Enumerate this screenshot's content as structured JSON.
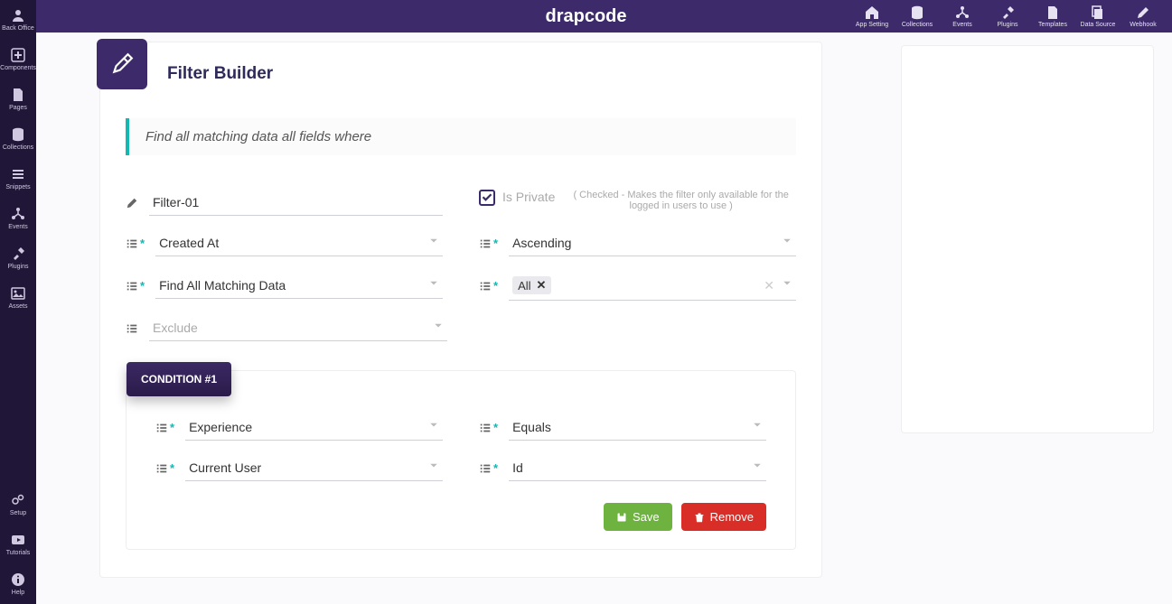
{
  "brand": "drapcode",
  "toolbar": [
    {
      "label": "App Setting",
      "icon": "home"
    },
    {
      "label": "Collections",
      "icon": "db"
    },
    {
      "label": "Events",
      "icon": "tree"
    },
    {
      "label": "Plugins",
      "icon": "tools"
    },
    {
      "label": "Templates",
      "icon": "doc"
    },
    {
      "label": "Data Source",
      "icon": "copy"
    },
    {
      "label": "Webhook",
      "icon": "pencil"
    }
  ],
  "leftRailTop": [
    {
      "label": "Back Office",
      "icon": "user"
    },
    {
      "label": "Components",
      "icon": "plus"
    },
    {
      "label": "Pages",
      "icon": "doc"
    },
    {
      "label": "Collections",
      "icon": "db"
    },
    {
      "label": "Snippets",
      "icon": "bars"
    },
    {
      "label": "Events",
      "icon": "tree"
    },
    {
      "label": "Plugins",
      "icon": "tools"
    },
    {
      "label": "Assets",
      "icon": "image"
    }
  ],
  "leftRailBottom": [
    {
      "label": "Setup",
      "icon": "gears"
    },
    {
      "label": "Tutorials",
      "icon": "play"
    },
    {
      "label": "Help",
      "icon": "info"
    }
  ],
  "page": {
    "title": "Filter Builder",
    "quote": "Find all matching data all fields where",
    "filterName": "Filter-01",
    "isPrivateLabel": "Is Private",
    "isPrivateHint": "( Checked - Makes the filter only available for the logged in users to use )",
    "sortField": "Created At",
    "sortOrder": "Ascending",
    "matchType": "Find All Matching Data",
    "tag": "All",
    "excludePh": "Exclude",
    "condition": {
      "badge": "CONDITION #1",
      "field": "Experience",
      "op": "Equals",
      "source": "Current User",
      "key": "Id"
    },
    "saveLabel": "Save",
    "removeLabel": "Remove"
  }
}
